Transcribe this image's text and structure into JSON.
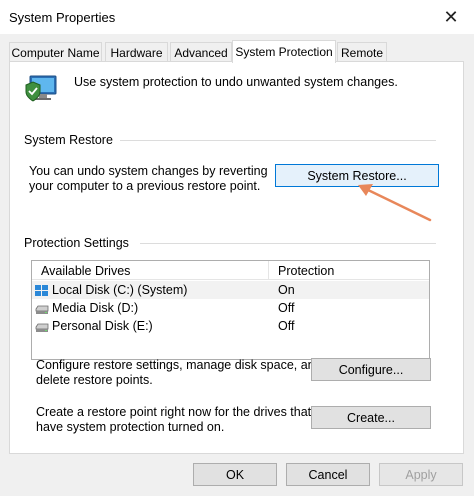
{
  "window": {
    "title": "System Properties",
    "close_glyph": "✕"
  },
  "tabs": [
    {
      "label": "Computer Name",
      "active": false
    },
    {
      "label": "Hardware",
      "active": false
    },
    {
      "label": "Advanced",
      "active": false
    },
    {
      "label": "System Protection",
      "active": true
    },
    {
      "label": "Remote",
      "active": false
    }
  ],
  "intro": {
    "icon": "computer-shield-icon",
    "text": "Use system protection to undo unwanted system changes."
  },
  "system_restore": {
    "group_label": "System Restore",
    "description_line1": "You can undo system changes by reverting",
    "description_line2": "your computer to a previous restore point.",
    "button_label": "System Restore..."
  },
  "protection_settings": {
    "group_label": "Protection Settings",
    "columns": [
      "Available Drives",
      "Protection"
    ],
    "drives": [
      {
        "name": "Local Disk (C:) (System)",
        "protection": "On",
        "icon": "windows-drive-icon"
      },
      {
        "name": "Media Disk (D:)",
        "protection": "Off",
        "icon": "drive-icon"
      },
      {
        "name": "Personal Disk (E:)",
        "protection": "Off",
        "icon": "drive-icon"
      }
    ],
    "configure_text_line1": "Configure restore settings, manage disk space, and",
    "configure_text_line2": "delete restore points.",
    "configure_button": "Configure...",
    "create_text_line1": "Create a restore point right now for the drives that",
    "create_text_line2": "have system protection turned on.",
    "create_button": "Create..."
  },
  "footer": {
    "ok": "OK",
    "cancel": "Cancel",
    "apply": "Apply"
  },
  "colors": {
    "arrow": "#e8875a",
    "focus_border": "#0078d7"
  }
}
